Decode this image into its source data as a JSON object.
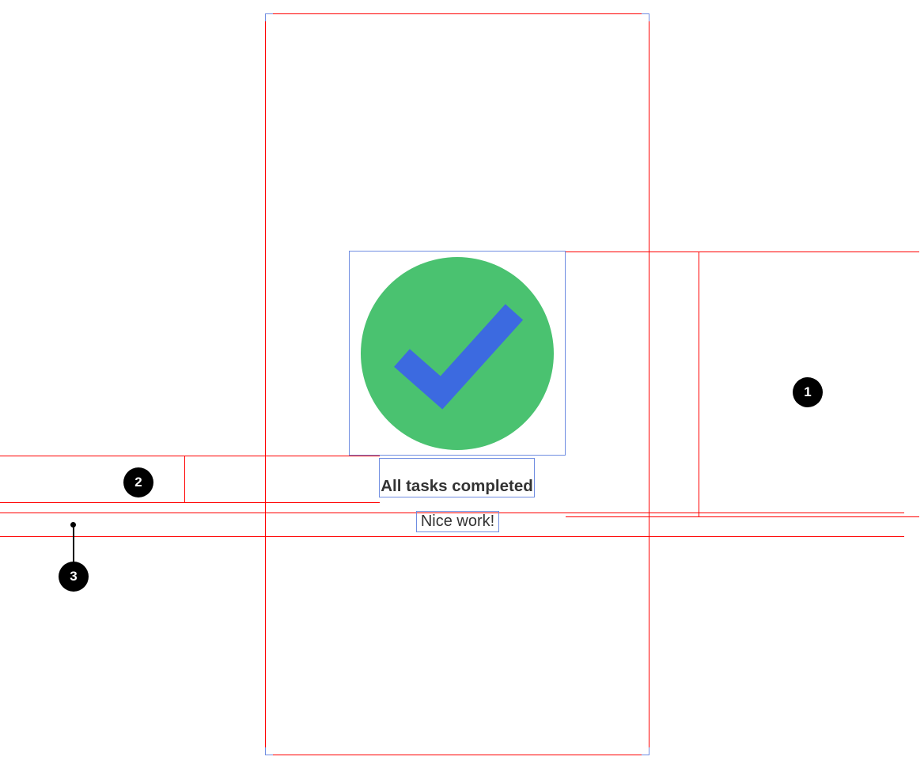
{
  "artboard": {
    "corner_color": "#6f8de1"
  },
  "content": {
    "icon_name": "check-circle-icon",
    "circle_fill": "#4ac270",
    "check_fill": "#3c6ae0",
    "title": "All tasks completed",
    "subtitle": "Nice work!"
  },
  "annotations": {
    "a1": "1",
    "a2": "2",
    "a3": "3"
  }
}
